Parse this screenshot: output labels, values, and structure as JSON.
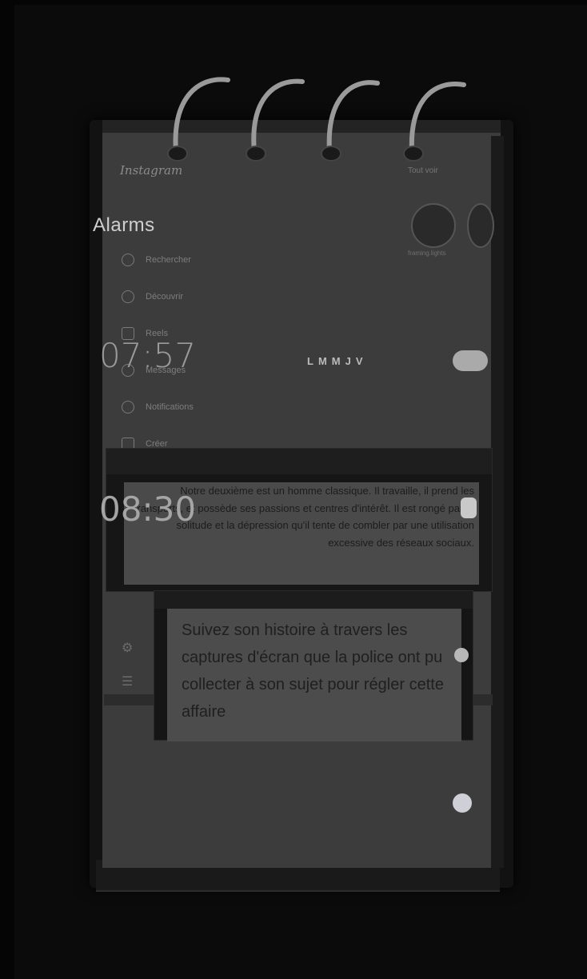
{
  "instagram": {
    "logo": "Instagram",
    "top_right": "Tout voir",
    "nav": [
      "Rechercher",
      "Découvrir",
      "Reels",
      "Messages",
      "Notifications",
      "Créer"
    ],
    "story_label_1": "framing.lights"
  },
  "alarm": {
    "title": "Alarms",
    "time_1": "07:57",
    "days_1": "LMMJV",
    "time_2": "08:30"
  },
  "text_window_1": {
    "paragraph": "Notre deuxième est un homme classique. Il travaille, il prend les transports, et possède ses passions et centres d'intérêt. Il est rongé par la solitude et la dépression qu'il tente de combler par une utilisation excessive des réseaux sociaux."
  },
  "text_window_2": {
    "paragraph": "Suivez son histoire à travers les captures d'écran que la police ont pu collecter à son sujet pour régler cette affaire"
  },
  "colors": {
    "background": "#050505",
    "page": "#3c3c3c"
  }
}
